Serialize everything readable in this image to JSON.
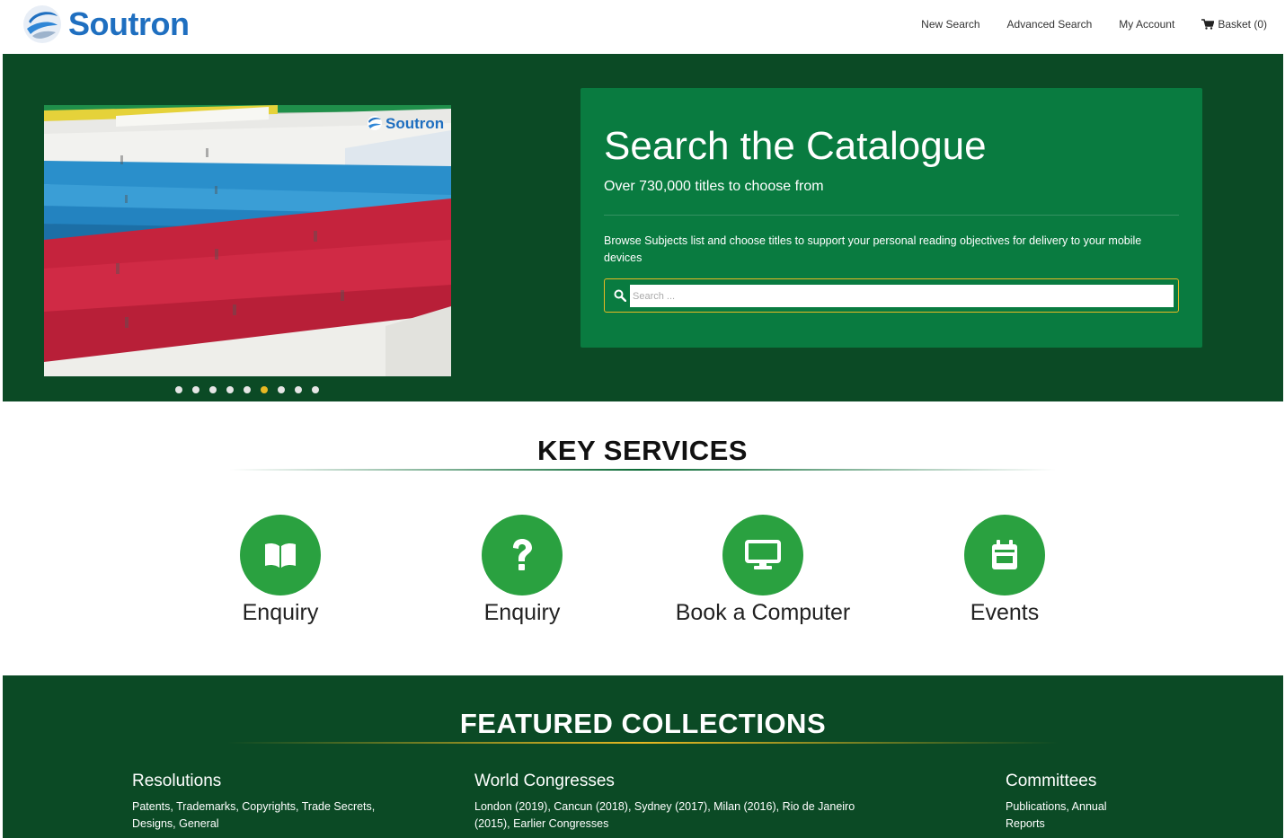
{
  "brand": {
    "name": "Soutron",
    "color": "#1f6fc0"
  },
  "nav": {
    "new_search": "New Search",
    "advanced_search": "Advanced Search",
    "my_account": "My Account",
    "basket": "Basket (0)"
  },
  "hero": {
    "image_watermark": "Soutron",
    "carousel": {
      "total_slides": 9,
      "active_index": 5
    },
    "search": {
      "title": "Search the Catalogue",
      "subtitle": "Over 730,000 titles to choose from",
      "description": "Browse Subjects list and choose titles to support your personal reading objectives for delivery to your mobile devices",
      "placeholder": "Search ..."
    }
  },
  "key_services": {
    "title": "KEY SERVICES",
    "items": [
      {
        "label": "Enquiry",
        "icon": "book-open-icon"
      },
      {
        "label": "Enquiry",
        "icon": "question-mark-icon"
      },
      {
        "label": "Book a Computer",
        "icon": "desktop-icon"
      },
      {
        "label": "Events",
        "icon": "calendar-icon"
      }
    ]
  },
  "featured": {
    "title": "FEATURED COLLECTIONS",
    "collections": [
      {
        "title": "Resolutions",
        "text": "Patents, Trademarks, Copyrights, Trade Secrets, Designs, General"
      },
      {
        "title": "World Congresses",
        "text": "London (2019), Cancun (2018), Sydney (2017), Milan (2016), Rio de Janeiro (2015), Earlier Congresses"
      },
      {
        "title": "Committees",
        "text": "Publications, Annual Reports"
      }
    ]
  },
  "colors": {
    "dark_green": "#0b4a25",
    "panel_green": "#097b40",
    "service_green": "#2aa140",
    "accent_gold": "#e8b923"
  }
}
